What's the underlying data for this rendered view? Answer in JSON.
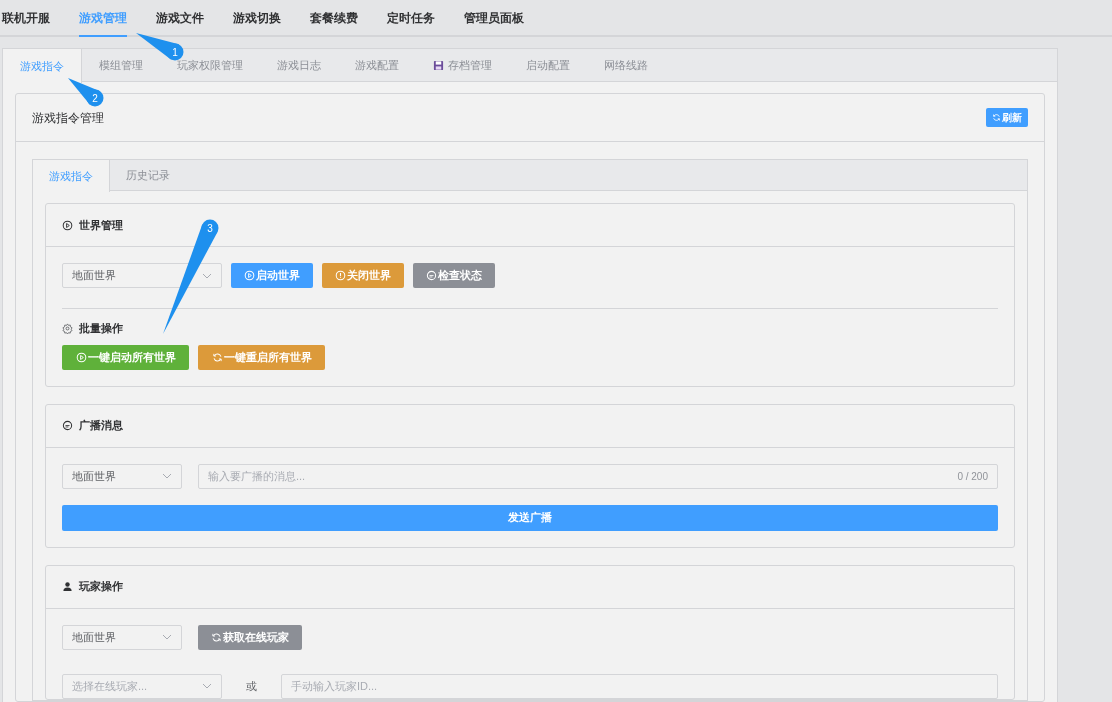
{
  "top_nav": [
    {
      "label": "联机开服",
      "selected": false
    },
    {
      "label": "游戏管理",
      "selected": true
    },
    {
      "label": "游戏文件",
      "selected": false
    },
    {
      "label": "游戏切换",
      "selected": false
    },
    {
      "label": "套餐续费",
      "selected": false
    },
    {
      "label": "定时任务",
      "selected": false
    },
    {
      "label": "管理员面板",
      "selected": false
    }
  ],
  "main_tabs": [
    {
      "label": "游戏指令",
      "selected": true,
      "kind": "text"
    },
    {
      "label": "模组管理",
      "selected": false,
      "kind": "text"
    },
    {
      "label": "玩家权限管理",
      "selected": false,
      "kind": "text"
    },
    {
      "label": "游戏日志",
      "selected": false,
      "kind": "text"
    },
    {
      "label": "游戏配置",
      "selected": false,
      "kind": "text"
    },
    {
      "label": "存档管理",
      "selected": false,
      "kind": "save"
    },
    {
      "label": "启动配置",
      "selected": false,
      "kind": "text"
    },
    {
      "label": "网络线路",
      "selected": false,
      "kind": "text"
    }
  ],
  "panel": {
    "title": "游戏指令管理",
    "refresh_button": "刷新"
  },
  "sub_tabs": [
    {
      "label": "游戏指令",
      "selected": true
    },
    {
      "label": "历史记录",
      "selected": false
    }
  ],
  "world_management": {
    "title": "世界管理",
    "world_select": {
      "value": "地面世界"
    },
    "buttons": [
      {
        "label": "启动世界",
        "kind": "primary"
      },
      {
        "label": "关闭世界",
        "kind": "warning"
      },
      {
        "label": "检查状态",
        "kind": "info"
      }
    ],
    "batch_title": "批量操作",
    "batch_buttons": [
      {
        "label": "一键启动所有世界",
        "kind": "success"
      },
      {
        "label": "一键重启所有世界",
        "kind": "warning"
      }
    ]
  },
  "broadcast": {
    "title": "广播消息",
    "world_select": {
      "value": "地面世界"
    },
    "message_field": {
      "placeholder": "输入要广播的消息...",
      "counter": "0 / 200"
    },
    "send_button": "发送广播"
  },
  "player_ops": {
    "title": "玩家操作",
    "world_select": {
      "value": "地面世界"
    },
    "fetch_button": "获取在线玩家",
    "player_select": {
      "placeholder": "选择在线玩家..."
    },
    "or_label": "或",
    "player_id_field": {
      "placeholder": "手动输入玩家ID..."
    }
  },
  "callouts": [
    {
      "label": "1"
    },
    {
      "label": "2"
    },
    {
      "label": "3"
    }
  ]
}
